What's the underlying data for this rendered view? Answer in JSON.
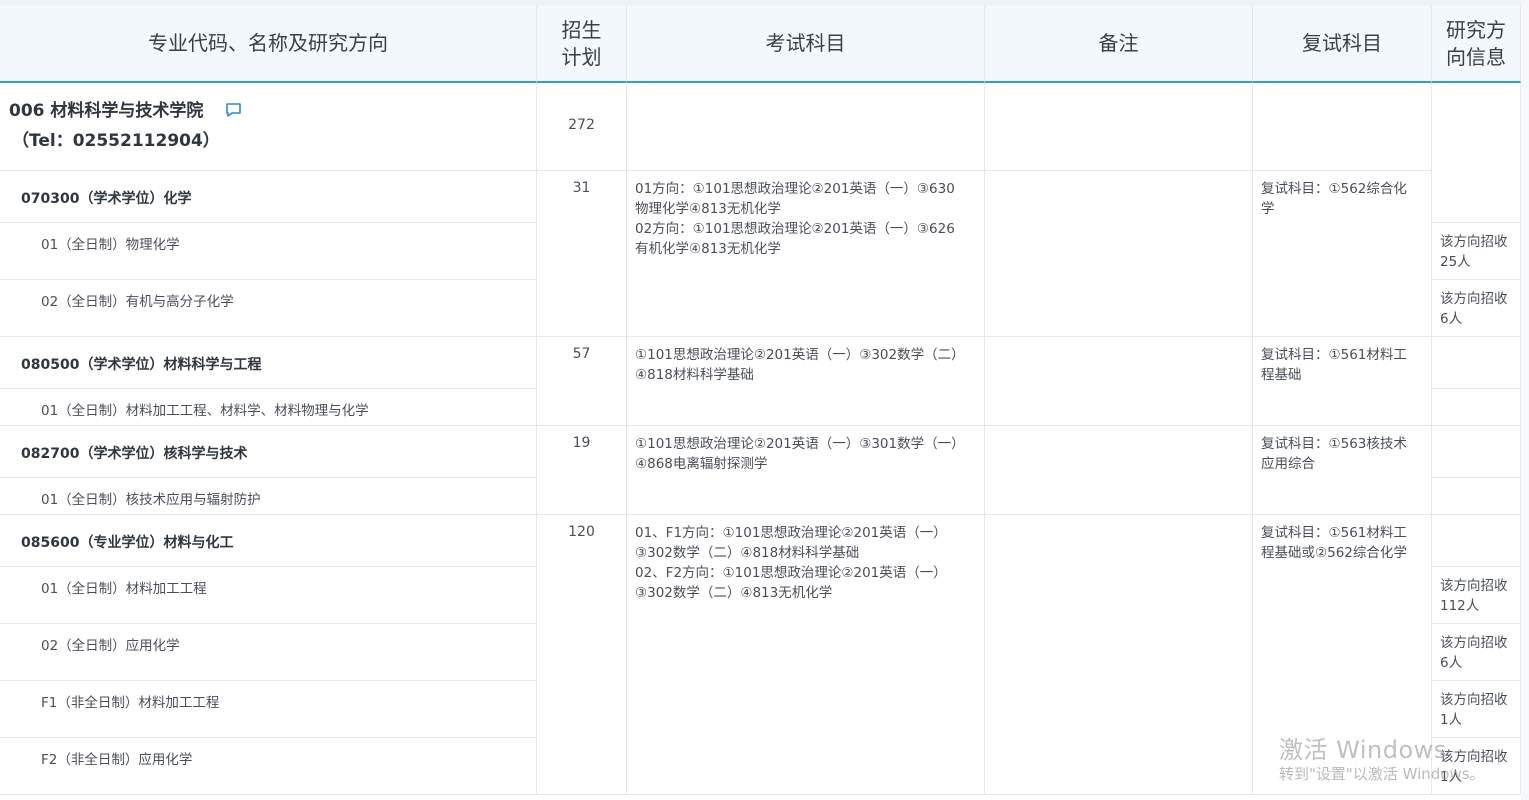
{
  "headers": [
    "专业代码、名称及研究方向",
    "招生\n计划",
    "考试科目",
    "备注",
    "复试科目",
    "研究方\n向信息"
  ],
  "college": {
    "name": "006 材料科学与技术学院",
    "tel": "（Tel：02552112904）",
    "plan": "272",
    "icon": "comment-icon"
  },
  "majors": [
    {
      "title": "070300（学术学位）化学",
      "plan": "31",
      "exam": [
        "01方向：①101思想政治理论②201英语（一）③630",
        "物理化学④813无机化学",
        "02方向：①101思想政治理论②201英语（一）③626",
        "有机化学④813无机化学"
      ],
      "retest": [
        "复试科目：①562综合化",
        "学"
      ],
      "directions": [
        {
          "name": "01（全日制）物理化学",
          "info": [
            "该方向招收",
            "25人"
          ]
        },
        {
          "name": "02（全日制）有机与高分子化学",
          "info": [
            "该方向招收",
            "6人"
          ]
        }
      ]
    },
    {
      "title": "080500（学术学位）材料科学与工程",
      "plan": "57",
      "exam": [
        "①101思想政治理论②201英语（一）③302数学（二）",
        "④818材料科学基础"
      ],
      "retest": [
        "复试科目：①561材料工",
        "程基础"
      ],
      "directions": [
        {
          "name": "01（全日制）材料加工工程、材料学、材料物理与化学",
          "info": []
        }
      ]
    },
    {
      "title": "082700（学术学位）核科学与技术",
      "plan": "19",
      "exam": [
        "①101思想政治理论②201英语（一）③301数学（一）",
        "④868电离辐射探测学"
      ],
      "retest": [
        "复试科目：①563核技术",
        "应用综合"
      ],
      "directions": [
        {
          "name": "01（全日制）核技术应用与辐射防护",
          "info": []
        }
      ]
    },
    {
      "title": "085600（专业学位）材料与化工",
      "plan": "120",
      "exam": [
        "01、F1方向：①101思想政治理论②201英语（一）",
        "③302数学（二）④818材料科学基础",
        "02、F2方向：①101思想政治理论②201英语（一）",
        "③302数学（二）④813无机化学"
      ],
      "retest": [
        "复试科目：①561材料工",
        "程基础或②562综合化学"
      ],
      "directions": [
        {
          "name": "01（全日制）材料加工工程",
          "info": [
            "该方向招收",
            "112人"
          ]
        },
        {
          "name": "02（全日制）应用化学",
          "info": [
            "该方向招收",
            "6人"
          ]
        },
        {
          "name": "F1（非全日制）材料加工工程",
          "info": [
            "该方向招收",
            "1人"
          ]
        },
        {
          "name": "F2（非全日制）应用化学",
          "info": [
            "该方向招收",
            "1人"
          ]
        }
      ]
    }
  ],
  "watermark": {
    "line1": "激活 Windows",
    "line2": "转到\"设置\"以激活 Windows。"
  },
  "colors": {
    "header_bg": "#f3f8fc",
    "header_underline": "#2aa3c6",
    "border": "#e6e8eb",
    "text": "#3a3f47",
    "icon": "#2a8ad8"
  }
}
